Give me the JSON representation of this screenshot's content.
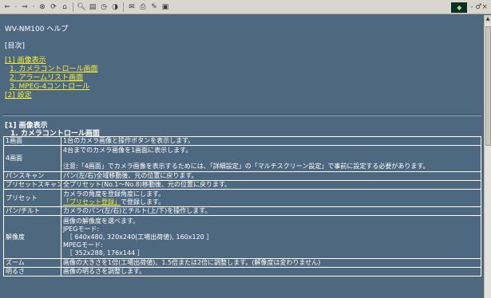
{
  "toolbar": {
    "icons": [
      "back-icon",
      "forward-icon",
      "stop-icon",
      "refresh-icon",
      "home-icon",
      "search-icon",
      "favorites-icon",
      "history-icon",
      "mail-icon",
      "print-icon",
      "edit-icon",
      "discuss-icon"
    ],
    "right_text": "- ♂×"
  },
  "page": {
    "title": "WV-NM100 ヘルプ",
    "toc_heading": "[目次]"
  },
  "toc": [
    {
      "label": "[1] 画像表示",
      "sub": false
    },
    {
      "label": "1. カメラコントロール画面",
      "sub": true
    },
    {
      "label": "2. アラームリスト画面",
      "sub": true
    },
    {
      "label": "3. MPEG-4コントロール",
      "sub": true
    },
    {
      "label": "[2] 設定",
      "sub": false
    }
  ],
  "section": {
    "heading": "[1] 画像表示",
    "subheading": "1. カメラコントロール画面"
  },
  "table": {
    "rows": [
      {
        "term": "1画面",
        "desc": [
          "1台のカメラ画像と操作ボタンを表示します。"
        ]
      },
      {
        "term": "4画面",
        "desc": [
          "4台までのカメラ画像を1画面に表示します。",
          "",
          "注意:「4画面」でカメラ画像を表示するためには、「詳細設定」の「マルチスクリーン設定」で事前に設定する必要があります。"
        ]
      },
      {
        "term": "パンスキャン",
        "desc": [
          "パン(左/右)全域移動後、元の位置に戻ります。"
        ]
      },
      {
        "term": "プリセットスキャン",
        "desc": [
          "全プリセット(No.1〜No.8)移動後、元の位置に戻ります。"
        ]
      },
      {
        "term": "プリセット",
        "desc": [
          "カメラの角度を登録角度にします。"
        ],
        "link": "「プリセット登録」",
        "link_suffix": "で登録します。"
      },
      {
        "term": "パン/チルト",
        "desc": [
          "カメラのパン(左/右)とチルト(上/下)を操作します。"
        ]
      },
      {
        "term": "解像度",
        "desc": [
          "画像の解像度を選べます。",
          "JPEGモード:",
          "［ 640x480, 320x240(工場出荷値), 160x120 ］",
          "MPEGモード:",
          "［ 352x288, 176x144 ］"
        ]
      },
      {
        "term": "ズーム",
        "desc": [
          "画像の大きさを1倍(工場出荷値)、1.5倍または2倍に調整します。(解像度は変わりません)"
        ]
      },
      {
        "term": "明るさ",
        "desc": [
          "画像の明るさを調整します。"
        ]
      }
    ]
  }
}
